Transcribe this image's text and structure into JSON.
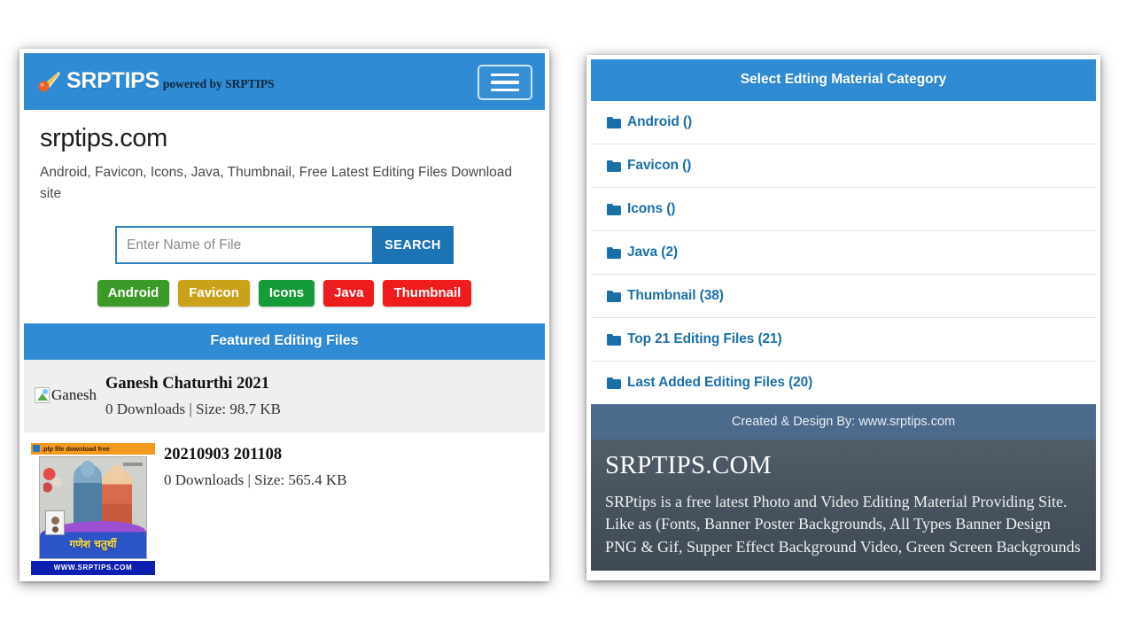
{
  "left_panel": {
    "header": {
      "logo_icon": "comet-icon",
      "brand": "SRPTIPS",
      "brand_sub": "powered by SRPTIPS",
      "menu_icon": "hamburger-menu-icon"
    },
    "site_title": "srptips.com",
    "site_description": "Android, Favicon, Icons, Java, Thumbnail, Free Latest Editing Files Download site",
    "search": {
      "placeholder": "Enter Name of File",
      "value": "",
      "button_label": "SEARCH"
    },
    "tags": [
      {
        "label": "Android",
        "color": "#3c9b28"
      },
      {
        "label": "Favicon",
        "color": "#c9a21a"
      },
      {
        "label": "Icons",
        "color": "#169b39"
      },
      {
        "label": "Java",
        "color": "#ee1c1c"
      },
      {
        "label": "Thumbnail",
        "color": "#ee1c1c"
      }
    ],
    "featured_heading": "Featured Editing Files",
    "files": [
      {
        "thumb_alt": "Ganesh",
        "title": "Ganesh Chaturthi 2021",
        "stats": "0 Downloads | Size: 98.7 KB"
      },
      {
        "thumb_top_label": ".plp file download free",
        "thumb_bottom_label": "WWW.SRPTIPS.COM",
        "thumb_caption": "गणेश चतुर्थी",
        "thumb_caption_sub": "srptips.com",
        "title": "20210903 201108",
        "stats": "0 Downloads | Size: 565.4 KB"
      },
      {
        "title": "",
        "stats": ""
      }
    ]
  },
  "right_panel": {
    "heading": "Select Edting Material Category",
    "categories": [
      {
        "label": "Android ()"
      },
      {
        "label": "Favicon ()"
      },
      {
        "label": "Icons ()"
      },
      {
        "label": "Java (2)"
      },
      {
        "label": "Thumbnail (38)"
      },
      {
        "label": "Top 21 Editing Files (21)"
      },
      {
        "label": "Last Added Editing Files (20)"
      }
    ],
    "credit": "Created & Design By: www.srptips.com",
    "footer_title": "SRPTIPS.COM",
    "footer_text": "SRPtips is a free latest Photo and Video Editing Material Providing Site. Like as (Fonts, Banner Poster Backgrounds, All Types Banner Design PNG & Gif, Supper Effect Background Video, Green Screen Backgrounds"
  },
  "colors": {
    "header_blue": "#2e8bd4",
    "search_btn_blue": "#1d74b5",
    "link_blue": "#1b6fa8",
    "credit_bar": "#4c6a8c",
    "footer_dark": "#47535f"
  }
}
